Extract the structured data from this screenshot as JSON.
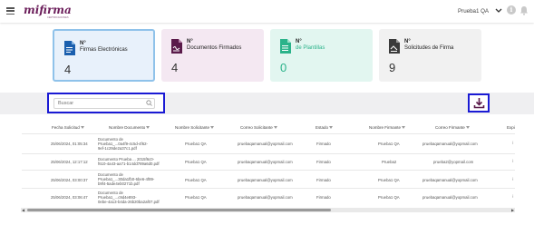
{
  "header": {
    "logo_text": "mifirma",
    "logo_sub": "CERTIFICACIONES",
    "user_name": "Prueba1 QA"
  },
  "colors": {
    "blue_card": "#e8f1fb",
    "blue_accent": "#1a5fae",
    "purple_card": "#f4e8f2",
    "purple_accent": "#5a1a4a",
    "green_card": "#e2f6f0",
    "green_accent": "#2bb38a",
    "gray_card": "#f1f1f1",
    "gray_accent": "#3a3a3a",
    "highlight": "#1a1ad4"
  },
  "cards": [
    {
      "title_n": "N°",
      "title": "Firmas Electrónicas",
      "value": "4"
    },
    {
      "title_n": "N°",
      "title": "Documentos Firmados",
      "value": "4"
    },
    {
      "title_n": "N°",
      "title": "de Plantillas",
      "value": "0"
    },
    {
      "title_n": "N°",
      "title": "Solicitudes de Firma",
      "value": "9"
    }
  ],
  "search": {
    "placeholder": "Buscar"
  },
  "table": {
    "headers": [
      "Fecha Solicitud",
      "Nombre Documento",
      "Nombre Solicitante",
      "Correo Solicitante",
      "Estado",
      "Nombre Firmante",
      "Correo Firmante",
      "Expi"
    ],
    "rows": [
      {
        "fecha": "25/06/2024, 01:05:34",
        "doc": [
          "Documento de",
          "Prueba1_...0a4f9-4c5d-4f62-",
          "9ef-1c29de2a37c1.pdf"
        ],
        "solicitante": "Prueba1 QA",
        "correo_sol": "pruebaqamanual@yopmail.com",
        "estado": "Firmado",
        "firmante": "Prueba1 QA",
        "correo_firm": "pruebaqamanual@yopmail.com"
      },
      {
        "fecha": "25/06/2024, 12:17:12",
        "doc": [
          "Documento Prueba ... 2015f6c0-",
          "f610-4a43-aa71-b14dd789a6d0.pdf"
        ],
        "solicitante": "Prueba1 QA",
        "correo_sol": "pruebaqamanual@yopmail.com",
        "estado": "Firmado",
        "firmante": "Prueba2",
        "correo_firm": "prueba2@yopmail.com"
      },
      {
        "fecha": "25/06/2024, 03:00:37",
        "doc": [
          "Documento de",
          "Prueba1_...30da1fb0-6be6-4f89-",
          "b9f4-5ade4eb0271b.pdf"
        ],
        "solicitante": "Prueba1 QA",
        "correo_sol": "pruebaqamanual@yopmail.com",
        "estado": "Firmado",
        "firmante": "Prueba1 QA",
        "correo_firm": "pruebaqamanual@yopmail.com"
      },
      {
        "fecha": "25/06/2024, 03:06:47",
        "doc": [
          "Documento de",
          "Prueba1_...c9d4e893-",
          "0ebe-4a13-b4da-26b20ba2af07.pdf"
        ],
        "solicitante": "Prueba1 QA",
        "correo_sol": "pruebaqamanual@yopmail.com",
        "estado": "Firmado",
        "firmante": "Prueba1 QA",
        "correo_firm": "pruebaqamanual@yopmail.com"
      }
    ],
    "row_action": "⁝"
  }
}
